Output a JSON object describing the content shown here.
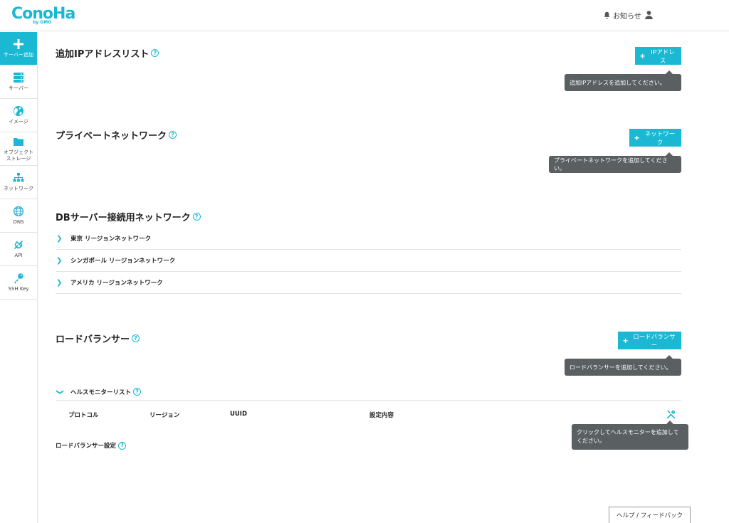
{
  "header": {
    "logo_text": "ConoHa",
    "logo_sub": "by GMO",
    "notice_label": "お知らせ"
  },
  "sidebar": {
    "items": [
      {
        "label": "サーバー追加",
        "icon": "plus-icon"
      },
      {
        "label": "サーバー",
        "icon": "server-icon"
      },
      {
        "label": "イメージ",
        "icon": "globe-image-icon"
      },
      {
        "label": "オブジェクト\nストレージ",
        "icon": "folder-icon"
      },
      {
        "label": "ネットワーク",
        "icon": "network-icon"
      },
      {
        "label": "DNS",
        "icon": "dns-globe-icon"
      },
      {
        "label": "API",
        "icon": "api-icon"
      },
      {
        "label": "SSH Key",
        "icon": "key-icon"
      }
    ]
  },
  "sections": {
    "ip": {
      "title": "追加IPアドレスリスト",
      "button": "IPアドレス",
      "tooltip": "追加IPアドレスを追加してください。"
    },
    "private": {
      "title": "プライベートネットワーク",
      "button": "ネットワーク",
      "tooltip": "プライベートネットワークを追加してください。"
    },
    "db": {
      "title": "DBサーバー接続用ネットワーク",
      "rows": [
        {
          "label": "東京 リージョンネットワーク"
        },
        {
          "label": "シンガポール リージョンネットワーク"
        },
        {
          "label": "アメリカ リージョンネットワーク"
        }
      ]
    },
    "lb": {
      "title": "ロードバランサー",
      "button": "ロードバランサー",
      "tooltip": "ロードバランサーを追加してください。",
      "health_monitor": {
        "title": "ヘルスモニターリスト",
        "columns": [
          "プロトコル",
          "リージョン",
          "UUID",
          "設定内容"
        ],
        "tooltip": "クリックしてヘルスモニターを追加してください。"
      },
      "settings_title": "ロードバランサー設定"
    }
  },
  "footer": {
    "feedback_label": "ヘルプ / フィードバック"
  },
  "colors": {
    "accent": "#1ab8d2",
    "tooltip_bg": "#5a5f61"
  }
}
